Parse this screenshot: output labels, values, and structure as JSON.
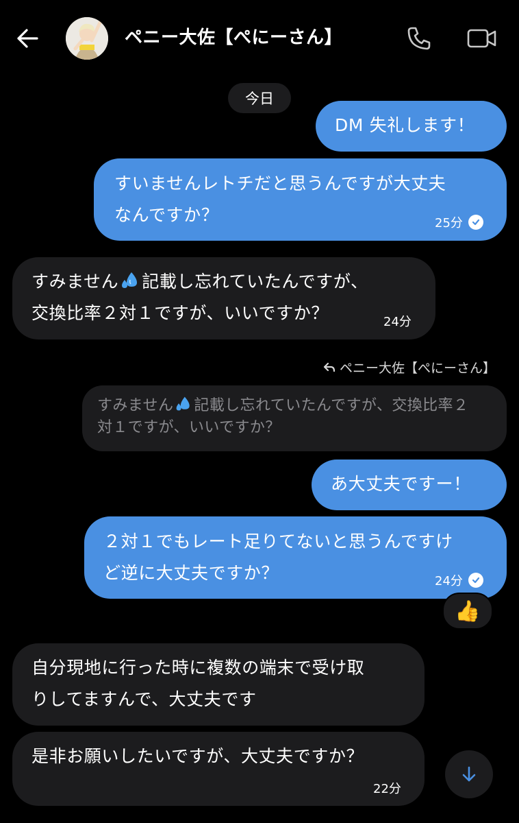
{
  "header": {
    "contact_name": "ペニー大佐【ぺにーさん】",
    "icons": [
      "back-arrow-icon",
      "phone-icon",
      "video-camera-icon"
    ]
  },
  "date_separator": "今日",
  "messages": [
    {
      "from": "me",
      "lines": [
        "DM 失礼します！"
      ]
    },
    {
      "from": "me",
      "lines": [
        "すいませんレトチだと思うんですが大丈夫",
        "なんですか？"
      ],
      "time": "25分",
      "read": true
    },
    {
      "from": "them",
      "lines": [
        "すみません",
        "記載し忘れていたんですが、",
        "交換比率２対１ですが、いいですか？"
      ],
      "time": "24分"
    },
    {
      "from": "me",
      "lines": [
        "あ大丈夫ですー！"
      ]
    },
    {
      "from": "me",
      "lines": [
        "２対１でもレート足りてないと思うんですけ",
        "ど逆に大丈夫ですか？"
      ],
      "time": "24分",
      "read": true,
      "reaction": "👍"
    },
    {
      "from": "them",
      "lines": [
        "自分現地に行った時に複数の端末で受け取",
        "りしてますんで、大丈夫です"
      ]
    },
    {
      "from": "them",
      "lines": [
        "是非お願いしたいですが、大丈夫ですか？"
      ],
      "time": "22分"
    }
  ],
  "reply_context": {
    "label": "ペニー大佐【ぺにーさん】",
    "quoted_lines": [
      "すみません",
      "記載し忘れていたんですが、交換比率２",
      "対１ですが、いいですか？"
    ]
  },
  "colors": {
    "background": "#000000",
    "outgoing_bubble": "#4a90e2",
    "incoming_bubble": "#1c1c1e",
    "accent": "#4a90e2"
  }
}
